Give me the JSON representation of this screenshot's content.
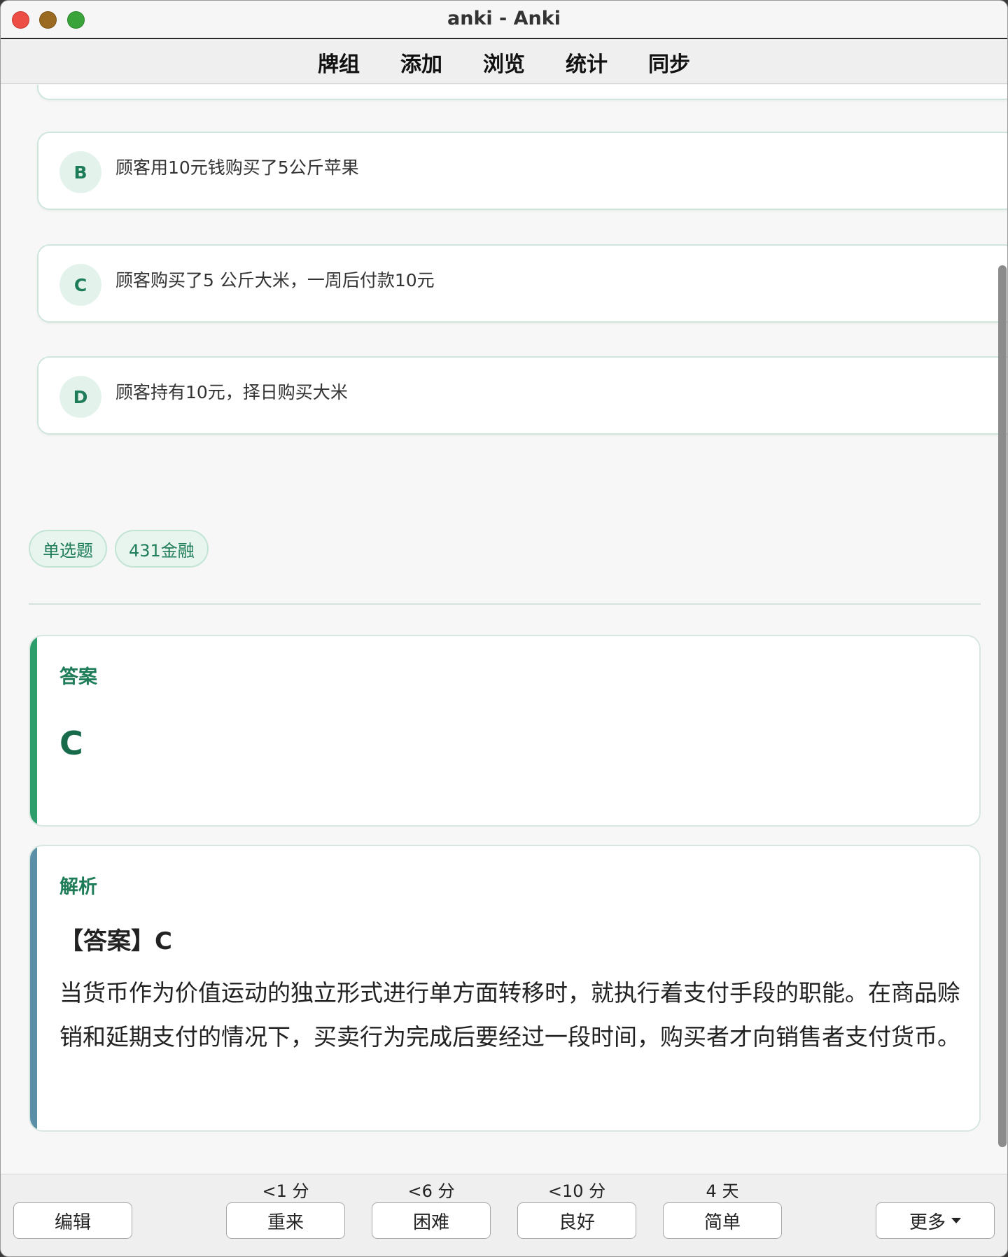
{
  "window": {
    "title": "anki - Anki"
  },
  "menu": [
    "牌组",
    "添加",
    "浏览",
    "统计",
    "同步"
  ],
  "options": [
    {
      "letter": "B",
      "text": "顾客用10元钱购买了5公斤苹果"
    },
    {
      "letter": "C",
      "text": "顾客购买了5 公斤大米，一周后付款10元"
    },
    {
      "letter": "D",
      "text": "顾客持有10元，择日购买大米"
    }
  ],
  "tags": [
    "单选题",
    "431金融"
  ],
  "answer": {
    "label": "答案",
    "value": "C"
  },
  "analysis": {
    "label": "解析",
    "head": "【答案】C",
    "body": "当货币作为价值运动的独立形式进行单方面转移时，就执行着支付手段的职能。在商品赊销和延期支付的情况下，买卖行为完成后要经过一段时间，购买者才向销售者支付货币。"
  },
  "bottom": {
    "edit_label": "编辑",
    "more_label": "更多",
    "answers": [
      {
        "interval": "<1 分",
        "label": "重来"
      },
      {
        "interval": "<6 分",
        "label": "困难"
      },
      {
        "interval": "<10 分",
        "label": "良好"
      },
      {
        "interval": "4 天",
        "label": "简单"
      }
    ]
  },
  "colors": {
    "accent": "#1e7d58",
    "answer_bar": "#2e9d6c",
    "analysis_bar": "#5b8fa8"
  }
}
